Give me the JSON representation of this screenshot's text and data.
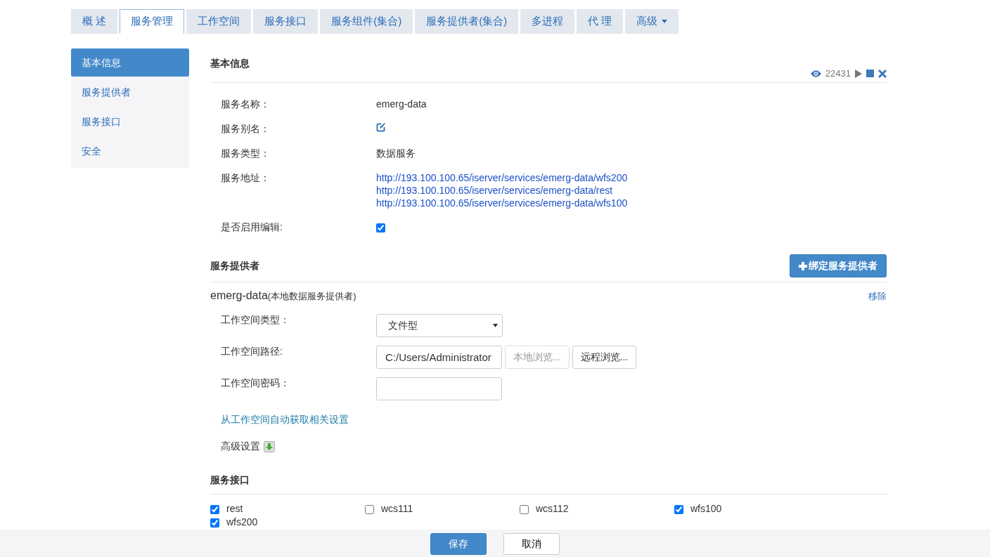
{
  "tabs": [
    {
      "label": "概 述",
      "selected": false
    },
    {
      "label": "服务管理",
      "selected": true
    },
    {
      "label": "工作空间",
      "selected": false
    },
    {
      "label": "服务接口",
      "selected": false
    },
    {
      "label": "服务组件(集合)",
      "selected": false
    },
    {
      "label": "服务提供者(集合)",
      "selected": false
    },
    {
      "label": "多进程",
      "selected": false
    },
    {
      "label": "代 理",
      "selected": false
    },
    {
      "label": "高级",
      "selected": false,
      "dropdown": true
    }
  ],
  "sidebar": {
    "items": [
      {
        "label": "基本信息",
        "selected": true
      },
      {
        "label": "服务提供者",
        "selected": false
      },
      {
        "label": "服务接口",
        "selected": false
      },
      {
        "label": "安全",
        "selected": false
      }
    ]
  },
  "basic_info": {
    "title": "基本信息",
    "visits": "22431",
    "fields": [
      {
        "kind": "text",
        "label": "服务名称：",
        "value": "emerg-data"
      },
      {
        "kind": "edit",
        "label": "服务别名："
      },
      {
        "kind": "text",
        "label": "服务类型：",
        "value": "数据服务"
      },
      {
        "kind": "links",
        "label": "服务地址：",
        "links": [
          "http://193.100.100.65/iserver/services/emerg-data/wfs200",
          "http://193.100.100.65/iserver/services/emerg-data/rest",
          "http://193.100.100.65/iserver/services/emerg-data/wfs100"
        ]
      },
      {
        "kind": "check",
        "label": "是否启用编辑:",
        "checked": true
      }
    ]
  },
  "providers": {
    "title": "服务提供者",
    "bind_button": "绑定服务提供者",
    "name": "emerg-data",
    "type": "(本地数据服务提供者)",
    "remove": "移除",
    "workspace_type": {
      "label": "工作空间类型：",
      "value": "文件型"
    },
    "workspace_path": {
      "label": "工作空间路径:",
      "value": "C:/Users/Administrator",
      "local_browse": "本地浏览...",
      "local_disabled": true,
      "remote_browse": "远程浏览..."
    },
    "workspace_password": {
      "label": "工作空间密码："
    },
    "auto_link": "从工作空间自动获取相关设置",
    "advanced": "高级设置"
  },
  "interfaces": {
    "title": "服务接口",
    "items": [
      {
        "label": "rest",
        "checked": true
      },
      {
        "label": "wcs111",
        "checked": false
      },
      {
        "label": "wcs112",
        "checked": false
      },
      {
        "label": "wfs100",
        "checked": true
      },
      {
        "label": "wfs200",
        "checked": true
      }
    ]
  },
  "footer": {
    "save": "保存",
    "cancel": "取消"
  }
}
